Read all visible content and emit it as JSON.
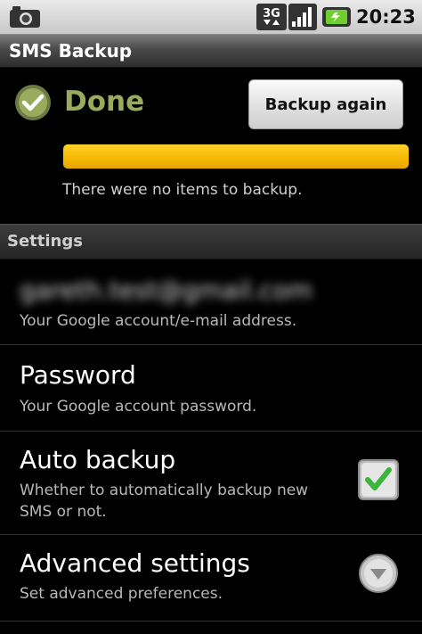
{
  "status_bar": {
    "time": "20:23",
    "network_badge": "3G",
    "icons": [
      "camera-icon",
      "3g-icon",
      "signal-icon",
      "battery-icon"
    ]
  },
  "app": {
    "title": "SMS Backup"
  },
  "status": {
    "label": "Done",
    "button_label": "Backup again",
    "progress": 1.0,
    "message": "There were no items to backup.",
    "accent_color": "#9aab5e",
    "progress_color": "#f5b800"
  },
  "settings": {
    "header": "Settings",
    "account": {
      "value": "gareth.test@gmail.com",
      "summary": "Your Google account/e-mail address."
    },
    "password": {
      "title": "Password",
      "summary": "Your Google account password."
    },
    "auto_backup": {
      "title": "Auto backup",
      "summary_line1": "Whether to automatically backup new",
      "summary_line2": "SMS or not.",
      "checked": true,
      "check_color": "#3bb53b"
    },
    "advanced": {
      "title": "Advanced settings",
      "summary": "Set advanced preferences."
    }
  }
}
